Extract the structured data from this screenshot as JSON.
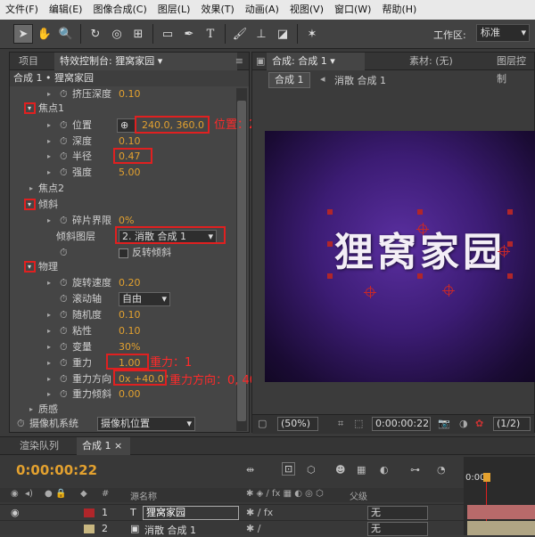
{
  "menu": [
    "文件(F)",
    "编辑(E)",
    "图像合成(C)",
    "图层(L)",
    "效果(T)",
    "动画(A)",
    "视图(V)",
    "窗口(W)",
    "帮助(H)"
  ],
  "workspace": {
    "label": "工作区:",
    "value": "标准"
  },
  "left_panel": {
    "tabs": [
      "项目",
      "特效控制台: 狸窝家园"
    ],
    "header": "合成 1 • 狸窝家园",
    "rows": {
      "squeeze": {
        "label": "挤压深度",
        "value": "0.10"
      },
      "focus1": {
        "label": "焦点1"
      },
      "position": {
        "label": "位置",
        "value": "240.0, 360.0"
      },
      "depth": {
        "label": "深度",
        "value": "0.10"
      },
      "radius": {
        "label": "半径",
        "value": "0.47"
      },
      "strength": {
        "label": "强度",
        "value": "5.00"
      },
      "focus2": {
        "label": "焦点2"
      },
      "tilt": {
        "label": "倾斜"
      },
      "frag_limit": {
        "label": "碎片界限",
        "value": "0%"
      },
      "tilt_layer": {
        "label": "倾斜图层",
        "value": "2. 消散 合成 1"
      },
      "reverse_tilt": {
        "label": "反转倾斜"
      },
      "physics": {
        "label": "物理"
      },
      "rot_speed": {
        "label": "旋转速度",
        "value": "0.20"
      },
      "roll_axis": {
        "label": "滚动轴",
        "value": "自由"
      },
      "randomness": {
        "label": "随机度",
        "value": "0.10"
      },
      "viscosity": {
        "label": "粘性",
        "value": "0.10"
      },
      "mass_var": {
        "label": "变量",
        "value": "30%"
      },
      "gravity": {
        "label": "重力",
        "value": "1.00"
      },
      "gravity_dir": {
        "label": "重力方向",
        "value": "0x +40.0°"
      },
      "gravity_tilt": {
        "label": "重力倾斜",
        "value": "0.00"
      },
      "texture": {
        "label": "质感"
      },
      "camera_system": {
        "label": "摄像机系统",
        "value": "摄像机位置"
      }
    },
    "annotations": {
      "position": "位置：240, 360",
      "gravity": "重力：1",
      "gravity_dir": "重力方向：0, 40"
    }
  },
  "right_panel": {
    "tabs": [
      "合成: 合成 1",
      "素材: (无)",
      "图层控制"
    ],
    "breadcrumb": [
      "合成 1",
      "消散 合成 1"
    ],
    "composition_text": "狸窝家园",
    "viewer_bar": {
      "zoom": "(50%)",
      "timecode": "0:00:00:22",
      "resolution": "(1/2)"
    }
  },
  "bottom_panel": {
    "tabs": [
      "渲染队列",
      "合成 1"
    ],
    "timecode": "0:00:00:22",
    "columns": {
      "num": "#",
      "name": "源名称",
      "parent": "父级"
    },
    "layers": [
      {
        "num": "1",
        "name": "狸窝家园",
        "parent": "无"
      },
      {
        "num": "2",
        "name": "消散 合成 1",
        "parent": "无"
      }
    ],
    "timeline_marker": "0:00s"
  },
  "colors": {
    "accent": "#e3a12f",
    "annotation": "#ff2a2a",
    "purple": "#5a2fa0"
  }
}
